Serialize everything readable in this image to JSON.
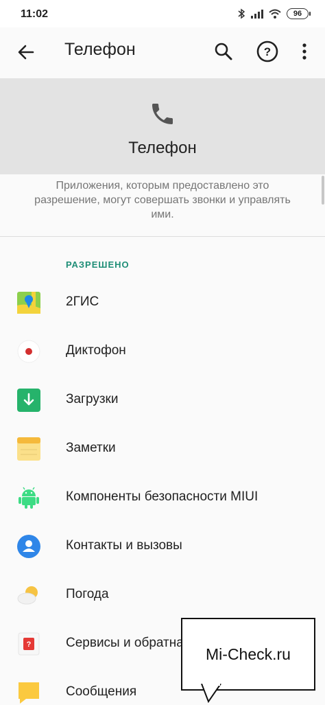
{
  "status_bar": {
    "time": "11:02",
    "battery": "96",
    "icons": [
      "bluetooth-icon",
      "signal-icon",
      "wifi-icon",
      "battery-icon"
    ]
  },
  "toolbar": {
    "title": "Телефон",
    "icons": [
      "back-arrow-icon",
      "search-icon",
      "help-icon",
      "more-vert-icon"
    ]
  },
  "header": {
    "title": "Телефон",
    "icon": "phone-icon"
  },
  "description": "Приложения, которым предоставлено это разрешение, могут совершать звонки и управлять ими.",
  "section": {
    "label": "РАЗРЕШЕНО"
  },
  "apps": [
    {
      "label": "2ГИС",
      "icon": "2gis-icon"
    },
    {
      "label": "Диктофон",
      "icon": "recorder-icon"
    },
    {
      "label": "Загрузки",
      "icon": "downloads-icon"
    },
    {
      "label": "Заметки",
      "icon": "notes-icon"
    },
    {
      "label": "Компоненты безопасности MIUI",
      "icon": "android-icon"
    },
    {
      "label": "Контакты и вызовы",
      "icon": "contacts-icon"
    },
    {
      "label": "Погода",
      "icon": "weather-icon"
    },
    {
      "label": "Сервисы и обратная связь",
      "icon": "feedback-icon"
    },
    {
      "label": "Сообщения",
      "icon": "messages-icon"
    }
  ],
  "watermark": "Mi-Check.ru",
  "colors": {
    "accent": "#1e8e77",
    "header_bg": "#e3e3e3",
    "background": "#fafafa"
  }
}
